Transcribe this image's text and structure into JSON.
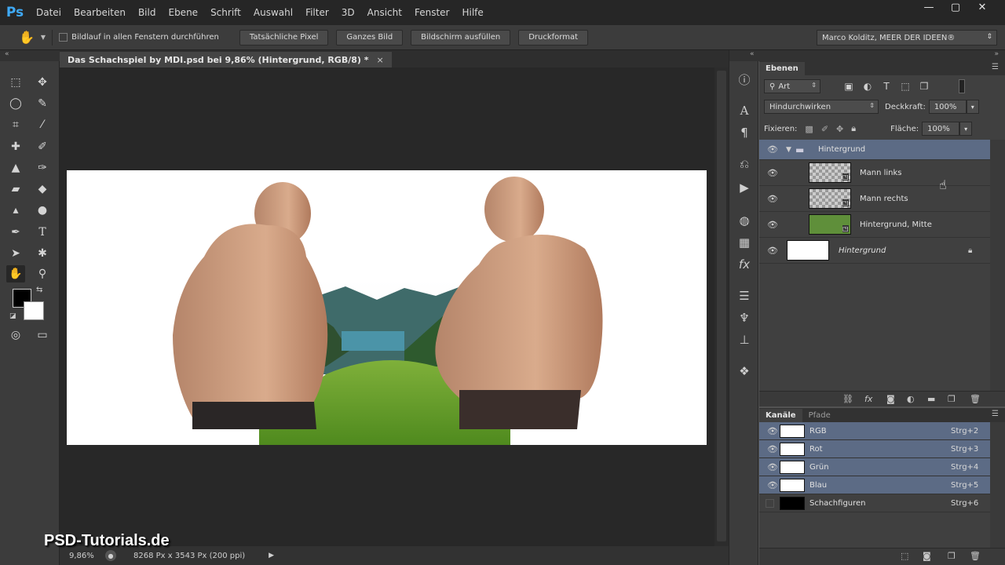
{
  "app": {
    "logo": "Ps"
  },
  "menu": [
    "Datei",
    "Bearbeiten",
    "Bild",
    "Ebene",
    "Schrift",
    "Auswahl",
    "Filter",
    "3D",
    "Ansicht",
    "Fenster",
    "Hilfe"
  ],
  "window_controls": {
    "minimize": "—",
    "maximize": "▢",
    "close": "✕"
  },
  "options": {
    "scroll_all_label": "Bildlauf in allen Fenstern durchführen",
    "buttons": [
      "Tatsächliche Pixel",
      "Ganzes Bild",
      "Bildschirm ausfüllen",
      "Druckformat"
    ],
    "workspace": "Marco Kolditz, MEER DER IDEEN®"
  },
  "document": {
    "tab_title": "Das Schachspiel by MDI.psd bei 9,86% (Hintergrund, RGB/8) *",
    "close": "×"
  },
  "status": {
    "zoom": "9,86%",
    "info": "8268 Px x 3543 Px (200 ppi)"
  },
  "watermark": "PSD-Tutorials.de",
  "layers_panel": {
    "tab": "Ebenen",
    "filter_kind": "Art",
    "blend_mode": "Hindurchwirken",
    "opacity_label": "Deckkraft:",
    "opacity_value": "100%",
    "lock_label": "Fixieren:",
    "fill_label": "Fläche:",
    "fill_value": "100%",
    "layers": [
      {
        "name": "Hintergrund",
        "type": "group",
        "selected": true
      },
      {
        "name": "Mann links",
        "type": "smart"
      },
      {
        "name": "Mann rechts",
        "type": "smart"
      },
      {
        "name": "Hintergrund, Mitte",
        "type": "smart"
      },
      {
        "name": "Hintergrund",
        "type": "background",
        "locked": true
      }
    ]
  },
  "channels_panel": {
    "tabs": [
      "Kanäle",
      "Pfade"
    ],
    "channels": [
      {
        "name": "RGB",
        "shortcut": "Strg+2",
        "selected": true
      },
      {
        "name": "Rot",
        "shortcut": "Strg+3",
        "selected": true
      },
      {
        "name": "Grün",
        "shortcut": "Strg+4",
        "selected": true
      },
      {
        "name": "Blau",
        "shortcut": "Strg+5",
        "selected": true
      },
      {
        "name": "Schachfiguren",
        "shortcut": "Strg+6",
        "selected": false
      }
    ]
  },
  "colors": {
    "accent_selected": "#5c6b85",
    "panel_bg": "#404040",
    "logo_blue": "#3fa9f5"
  }
}
